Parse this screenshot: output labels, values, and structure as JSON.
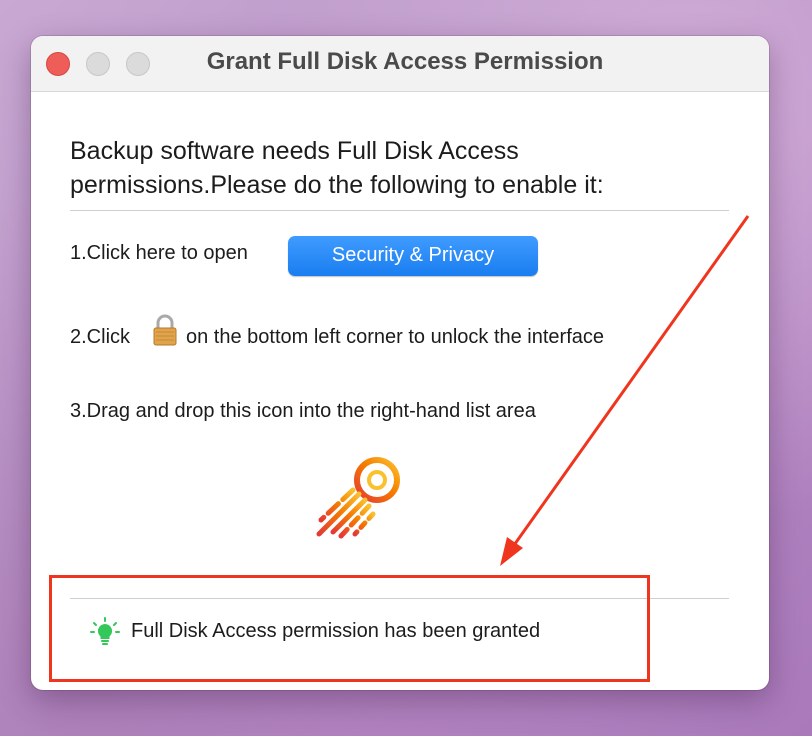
{
  "window": {
    "title": "Grant Full Disk Access Permission"
  },
  "content": {
    "heading": "Backup software needs Full Disk Access permissions.Please do the following to enable it:",
    "step1_text": "1.Click here to open",
    "security_button_label": "Security & Privacy",
    "step2_prefix": "2.Click",
    "step2_suffix": "on the bottom left corner to unlock the interface",
    "step3_text": "3.Drag and drop this icon into the right-hand list area",
    "status_text": "Full Disk Access permission has been granted"
  },
  "icons": {
    "lock": "lock-icon",
    "app": "app-icon",
    "status": "lightbulb-icon"
  },
  "colors": {
    "close": "#ee5d58",
    "button": "#1a7ef0",
    "status_green": "#34c759",
    "annotation_red": "#f0351e"
  }
}
